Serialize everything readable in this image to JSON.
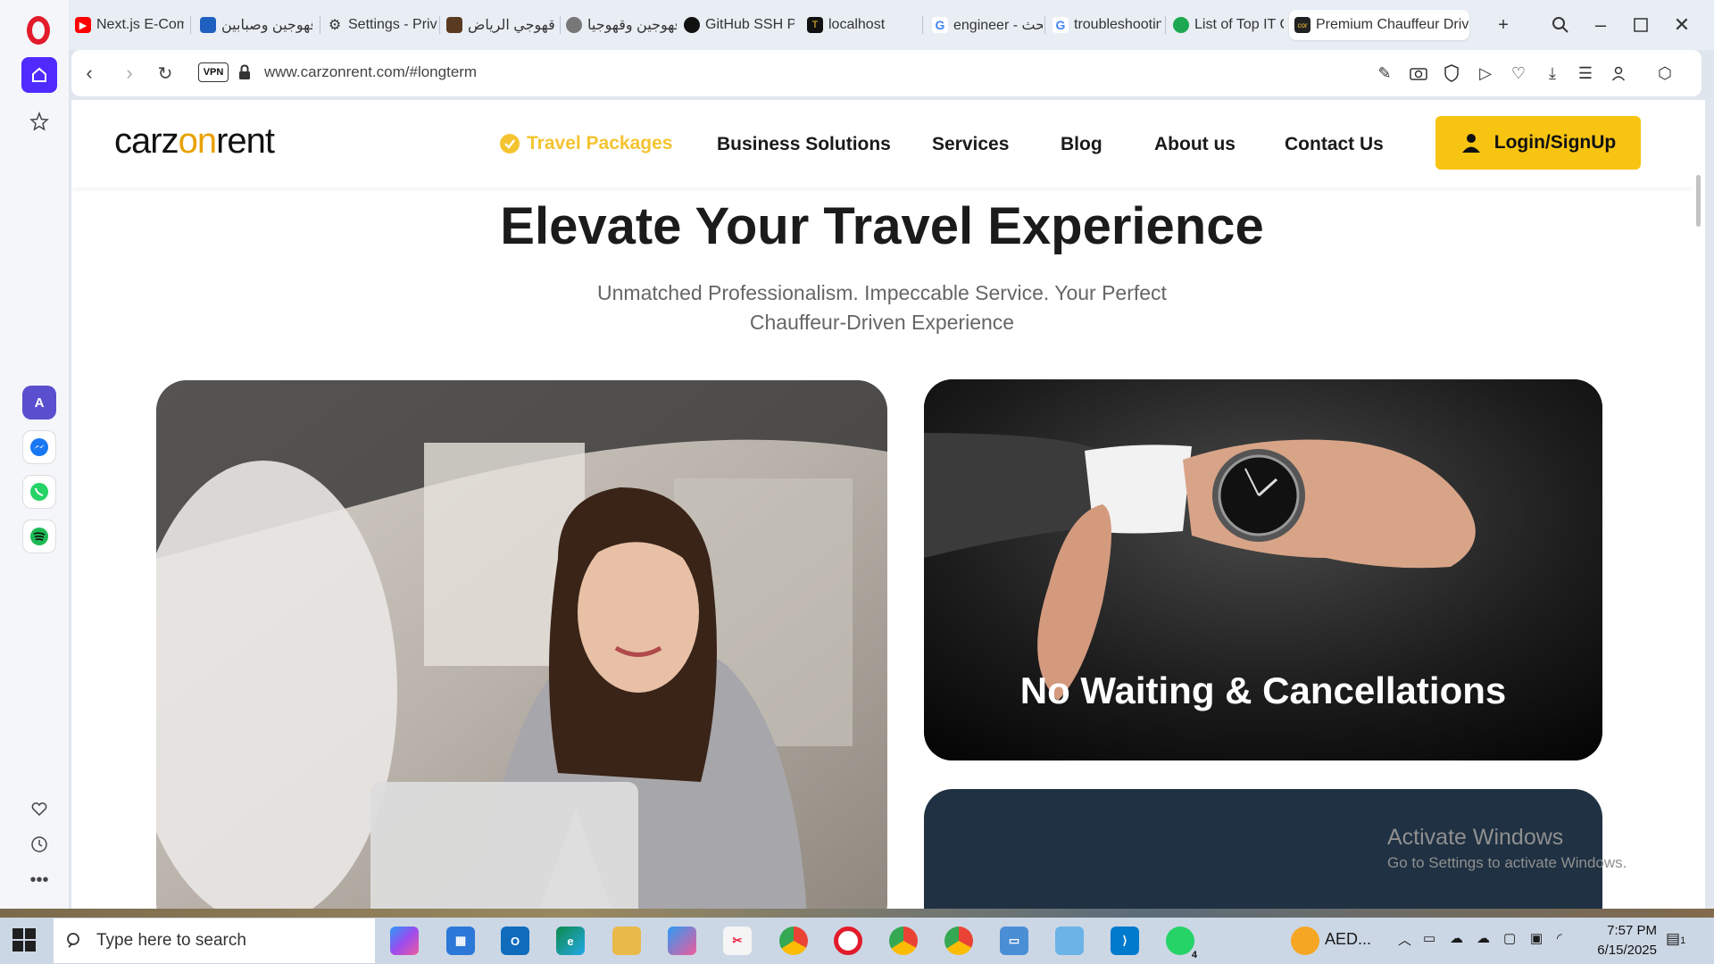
{
  "browser": {
    "tabs": [
      {
        "label": "Next.js E-Comm",
        "icon": "youtube-icon"
      },
      {
        "label": "قهوجين وصبابين",
        "icon": "site-favicon"
      },
      {
        "label": "Settings - Priva",
        "icon": "gear-icon"
      },
      {
        "label": "قهوجي الرياض",
        "icon": "coffee-icon"
      },
      {
        "label": "قهوجين وقهوجيا",
        "icon": "globe-icon"
      },
      {
        "label": "GitHub SSH Pe",
        "icon": "github-icon"
      },
      {
        "label": "localhost",
        "icon": "t-icon"
      },
      {
        "label": "engineer - بحث",
        "icon": "google-icon"
      },
      {
        "label": "troubleshootin",
        "icon": "google-icon"
      },
      {
        "label": "List of Top IT C",
        "icon": "leaf-icon"
      },
      {
        "label": "Premium Chauffeur Drive",
        "icon": "carzonrent-icon"
      }
    ],
    "vpn_label": "VPN",
    "url": "www.carzonrent.com/#longterm"
  },
  "site": {
    "logo_prefix": "carz",
    "logo_on": "on",
    "logo_suffix": "rent",
    "nav": {
      "travel_packages": "Travel Packages",
      "business_solutions": "Business Solutions",
      "services": "Services",
      "blog": "Blog",
      "about": "About us",
      "contact": "Contact Us"
    },
    "login_label": "Login/SignUp",
    "hero_title": "Elevate Your Travel Experience",
    "hero_subtitle": "Unmatched Professionalism. Impeccable Service. Your Perfect Chauffeur-Driven Experience",
    "card_caption": "No Waiting & Cancellations"
  },
  "watermark": {
    "line1": "Activate Windows",
    "line2": "Go to Settings to activate Windows."
  },
  "taskbar": {
    "search_placeholder": "Type here to search",
    "currency": "AED...",
    "time": "7:57 PM",
    "date": "6/15/2025",
    "whatsapp_badge": "4",
    "notification_count": "1"
  },
  "colors": {
    "accent_yellow": "#f7c412",
    "opera_red": "#e21b2b",
    "opera_purple": "#4f2bff"
  }
}
